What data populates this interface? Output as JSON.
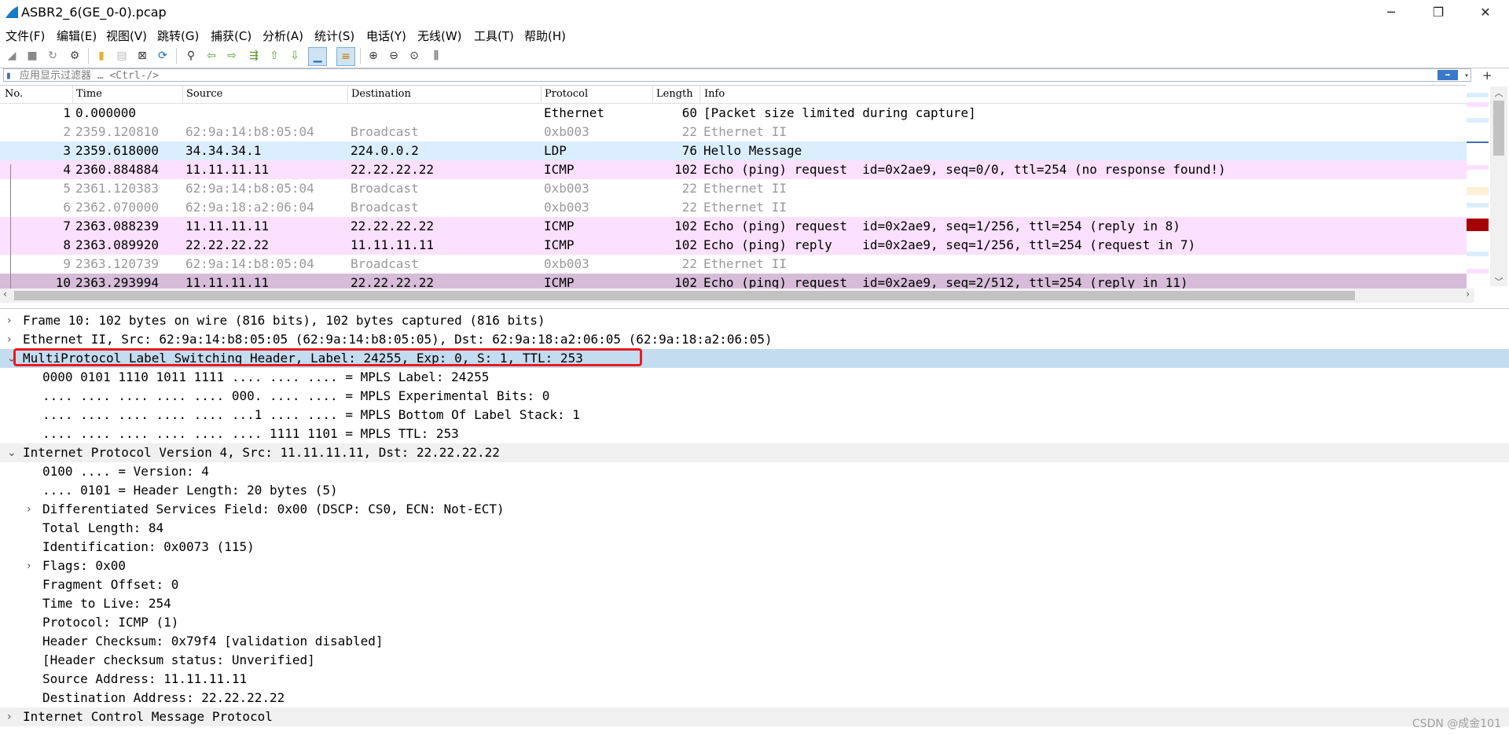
{
  "window": {
    "title": "ASBR2_6(GE_0-0).pcap",
    "minimize": "─",
    "maximize": "❐",
    "close": "✕"
  },
  "menu": [
    "文件(F)",
    "编辑(E)",
    "视图(V)",
    "跳转(G)",
    "捕获(C)",
    "分析(A)",
    "统计(S)",
    "电话(Y)",
    "无线(W)",
    "工具(T)",
    "帮助(H)"
  ],
  "filter": {
    "placeholder": "应用显示过滤器 … <Ctrl-/>"
  },
  "columns": [
    "No.",
    "Time",
    "Source",
    "Destination",
    "Protocol",
    "Length",
    "Info"
  ],
  "packets": [
    {
      "no": "1",
      "time": "0.000000",
      "src": "",
      "dst": "",
      "proto": "Ethernet",
      "len": "60",
      "info": "[Packet size limited during capture]",
      "bg": "#ffffff",
      "gray": false
    },
    {
      "no": "2",
      "time": "2359.120810",
      "src": "62:9a:14:b8:05:04",
      "dst": "Broadcast",
      "proto": "0xb003",
      "len": "22",
      "info": "Ethernet II",
      "bg": "#ffffff",
      "gray": true
    },
    {
      "no": "3",
      "time": "2359.618000",
      "src": "34.34.34.1",
      "dst": "224.0.0.2",
      "proto": "LDP",
      "len": "76",
      "info": "Hello Message",
      "bg": "#daeeff",
      "gray": false
    },
    {
      "no": "4",
      "time": "2360.884884",
      "src": "11.11.11.11",
      "dst": "22.22.22.22",
      "proto": "ICMP",
      "len": "102",
      "info": "Echo (ping) request  id=0x2ae9, seq=0/0, ttl=254 (no response found!)",
      "bg": "#fce0ff",
      "gray": false
    },
    {
      "no": "5",
      "time": "2361.120383",
      "src": "62:9a:14:b8:05:04",
      "dst": "Broadcast",
      "proto": "0xb003",
      "len": "22",
      "info": "Ethernet II",
      "bg": "#ffffff",
      "gray": true
    },
    {
      "no": "6",
      "time": "2362.070000",
      "src": "62:9a:18:a2:06:04",
      "dst": "Broadcast",
      "proto": "0xb003",
      "len": "22",
      "info": "Ethernet II",
      "bg": "#ffffff",
      "gray": true
    },
    {
      "no": "7",
      "time": "2363.088239",
      "src": "11.11.11.11",
      "dst": "22.22.22.22",
      "proto": "ICMP",
      "len": "102",
      "info": "Echo (ping) request  id=0x2ae9, seq=1/256, ttl=254 (reply in 8)",
      "bg": "#fce0ff",
      "gray": false
    },
    {
      "no": "8",
      "time": "2363.089920",
      "src": "22.22.22.22",
      "dst": "11.11.11.11",
      "proto": "ICMP",
      "len": "102",
      "info": "Echo (ping) reply    id=0x2ae9, seq=1/256, ttl=254 (request in 7)",
      "bg": "#fce0ff",
      "gray": false
    },
    {
      "no": "9",
      "time": "2363.120739",
      "src": "62:9a:14:b8:05:04",
      "dst": "Broadcast",
      "proto": "0xb003",
      "len": "22",
      "info": "Ethernet II",
      "bg": "#ffffff",
      "gray": true
    },
    {
      "no": "10",
      "time": "2363.293994",
      "src": "11.11.11.11",
      "dst": "22.22.22.22",
      "proto": "ICMP",
      "len": "102",
      "info": "Echo (ping) request  id=0x2ae9, seq=2/512, ttl=254 (reply in 11)",
      "bg": "#d6bcd8",
      "gray": false
    }
  ],
  "details": [
    {
      "indent": 0,
      "arrow": ">",
      "text": "Frame 10: 102 bytes on wire (816 bits), 102 bytes captured (816 bits)",
      "bg": "#ffffff"
    },
    {
      "indent": 0,
      "arrow": ">",
      "text": "Ethernet II, Src: 62:9a:14:b8:05:05 (62:9a:14:b8:05:05), Dst: 62:9a:18:a2:06:05 (62:9a:18:a2:06:05)",
      "bg": "#ffffff"
    },
    {
      "indent": 0,
      "arrow": "v",
      "text": "MultiProtocol Label Switching Header, Label: 24255, Exp: 0, S: 1, TTL: 253",
      "bg": "#c4dcf0"
    },
    {
      "indent": 1,
      "arrow": "",
      "text": "0000 0101 1110 1011 1111 .... .... .... = MPLS Label: 24255",
      "bg": "#ffffff"
    },
    {
      "indent": 1,
      "arrow": "",
      "text": ".... .... .... .... .... 000. .... .... = MPLS Experimental Bits: 0",
      "bg": "#ffffff"
    },
    {
      "indent": 1,
      "arrow": "",
      "text": ".... .... .... .... .... ...1 .... .... = MPLS Bottom Of Label Stack: 1",
      "bg": "#ffffff"
    },
    {
      "indent": 1,
      "arrow": "",
      "text": ".... .... .... .... .... .... 1111 1101 = MPLS TTL: 253",
      "bg": "#ffffff"
    },
    {
      "indent": 0,
      "arrow": "v",
      "text": "Internet Protocol Version 4, Src: 11.11.11.11, Dst: 22.22.22.22",
      "bg": "#f0f0f0"
    },
    {
      "indent": 1,
      "arrow": "",
      "text": "0100 .... = Version: 4",
      "bg": "#ffffff"
    },
    {
      "indent": 1,
      "arrow": "",
      "text": ".... 0101 = Header Length: 20 bytes (5)",
      "bg": "#ffffff"
    },
    {
      "indent": 1,
      "arrow": ">",
      "text": "Differentiated Services Field: 0x00 (DSCP: CS0, ECN: Not-ECT)",
      "bg": "#ffffff"
    },
    {
      "indent": 1,
      "arrow": "",
      "text": "Total Length: 84",
      "bg": "#ffffff"
    },
    {
      "indent": 1,
      "arrow": "",
      "text": "Identification: 0x0073 (115)",
      "bg": "#ffffff"
    },
    {
      "indent": 1,
      "arrow": ">",
      "text": "Flags: 0x00",
      "bg": "#ffffff"
    },
    {
      "indent": 1,
      "arrow": "",
      "text": "Fragment Offset: 0",
      "bg": "#ffffff"
    },
    {
      "indent": 1,
      "arrow": "",
      "text": "Time to Live: 254",
      "bg": "#ffffff"
    },
    {
      "indent": 1,
      "arrow": "",
      "text": "Protocol: ICMP (1)",
      "bg": "#ffffff"
    },
    {
      "indent": 1,
      "arrow": "",
      "text": "Header Checksum: 0x79f4 [validation disabled]",
      "bg": "#ffffff"
    },
    {
      "indent": 1,
      "arrow": "",
      "text": "[Header checksum status: Unverified]",
      "bg": "#ffffff"
    },
    {
      "indent": 1,
      "arrow": "",
      "text": "Source Address: 11.11.11.11",
      "bg": "#ffffff"
    },
    {
      "indent": 1,
      "arrow": "",
      "text": "Destination Address: 22.22.22.22",
      "bg": "#ffffff"
    },
    {
      "indent": 0,
      "arrow": ">",
      "text": "Internet Control Message Protocol",
      "bg": "#f0f0f0"
    }
  ],
  "watermark": "CSDN @成金101",
  "colors": {
    "highlight_box": "#e81c1c",
    "selected_detail": "#c4dcf0",
    "icmp_row": "#fce0ff",
    "ldp_row": "#daeeff"
  }
}
